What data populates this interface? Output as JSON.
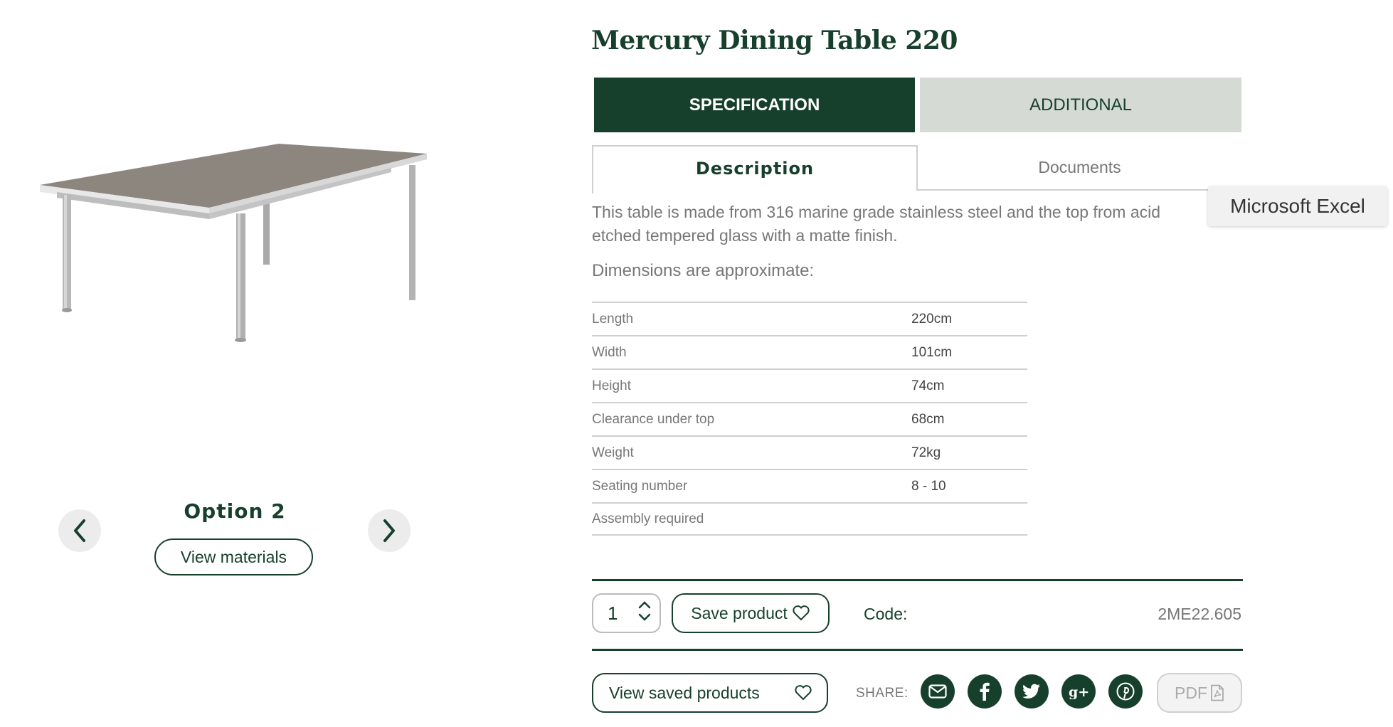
{
  "product": {
    "title": "Mercury Dining Table 220",
    "image_alt": "table-photo"
  },
  "carousel": {
    "option_label": "Option 2",
    "view_materials": "View materials"
  },
  "tabs": {
    "main": [
      {
        "label": "SPECIFICATION",
        "active": true
      },
      {
        "label": "ADDITIONAL",
        "active": false
      }
    ],
    "sub": [
      {
        "label": "Description",
        "active": true
      },
      {
        "label": "Documents",
        "active": false
      }
    ]
  },
  "tooltip": "Microsoft Excel",
  "description": {
    "text": "This table is made from 316 marine grade stainless steel and the top from acid etched tempered glass with a matte finish.",
    "dims_heading": "Dimensions are approximate:"
  },
  "specs": [
    {
      "label": "Length",
      "value": "220cm"
    },
    {
      "label": "Width",
      "value": "101cm"
    },
    {
      "label": "Height",
      "value": "74cm"
    },
    {
      "label": "Clearance under top",
      "value": "68cm"
    },
    {
      "label": "Weight",
      "value": "72kg"
    },
    {
      "label": "Seating number",
      "value": "8 - 10"
    },
    {
      "label": "Assembly required",
      "value": ""
    }
  ],
  "purchase": {
    "quantity": "1",
    "save_label": "Save product",
    "code_label": "Code:",
    "code_value": "2ME22.605"
  },
  "footer": {
    "view_saved": "View saved products",
    "share_label": "SHARE:",
    "share_icons": [
      "email-icon",
      "facebook-icon",
      "twitter-icon",
      "google-plus-icon",
      "pinterest-icon"
    ],
    "pdf_label": "PDF"
  },
  "colors": {
    "brand_green": "#17402c",
    "tab_inactive_bg": "#d5dad4"
  }
}
